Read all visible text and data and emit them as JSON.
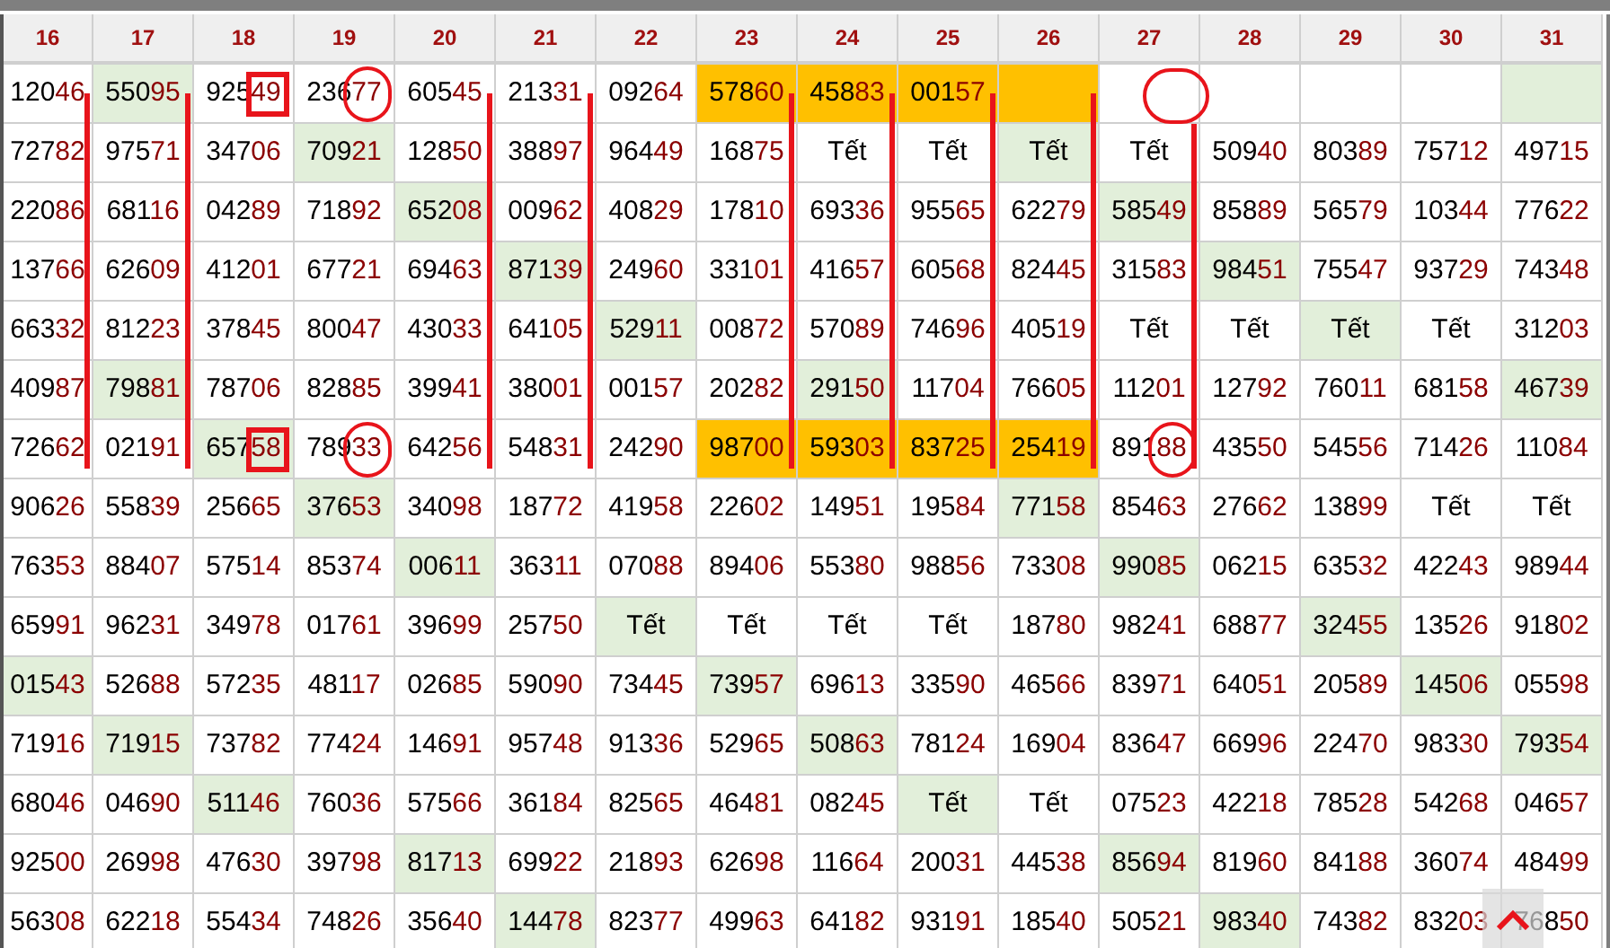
{
  "table": {
    "columns": [
      "16",
      "17",
      "18",
      "19",
      "20",
      "21",
      "22",
      "23",
      "24",
      "25",
      "26",
      "27",
      "28",
      "29",
      "30",
      "31"
    ],
    "rows": [
      {
        "cells": [
          {
            "text": "12046",
            "line": true
          },
          {
            "text": "55095",
            "color": "#e2efda",
            "line": true
          },
          {
            "text": "92549",
            "boxed": true
          },
          {
            "text": "23677",
            "circled": true
          },
          {
            "text": "60545",
            "line": true
          },
          {
            "text": "21331",
            "line": true
          },
          {
            "text": "09264"
          },
          {
            "text": "57860",
            "color": "#ffc000",
            "line": true
          },
          {
            "text": "45883",
            "color": "#ffc000",
            "line": true
          },
          {
            "text": "00157",
            "color": "#ffc000",
            "line": true
          },
          {
            "color": "#ffc000",
            "line": true
          },
          {
            "circled": true,
            "line": true
          },
          {},
          {},
          {},
          {
            "color": "#e2efda"
          }
        ]
      },
      {
        "cells": [
          {
            "text": "72782"
          },
          {
            "text": "97571"
          },
          {
            "text": "34706"
          },
          {
            "text": "70921",
            "color": "#e2efda"
          },
          {
            "text": "12850"
          },
          {
            "text": "38897"
          },
          {
            "text": "96449"
          },
          {
            "text": "16875"
          },
          {
            "text": "Tết"
          },
          {
            "text": "Tết"
          },
          {
            "text": "Tết",
            "color": "#e2efda"
          },
          {
            "text": "Tết"
          },
          {
            "text": "50940"
          },
          {
            "text": "80389"
          },
          {
            "text": "75712"
          },
          {
            "text": "49715"
          }
        ]
      },
      {
        "cells": [
          {
            "text": "22086"
          },
          {
            "text": "68116"
          },
          {
            "text": "04289"
          },
          {
            "text": "71892"
          },
          {
            "text": "65208",
            "color": "#e2efda"
          },
          {
            "text": "00962"
          },
          {
            "text": "40829"
          },
          {
            "text": "17810"
          },
          {
            "text": "69336"
          },
          {
            "text": "95565"
          },
          {
            "text": "62279"
          },
          {
            "text": "58549",
            "color": "#e2efda"
          },
          {
            "text": "85889"
          },
          {
            "text": "56579"
          },
          {
            "text": "10344"
          },
          {
            "text": "77622"
          }
        ]
      },
      {
        "cells": [
          {
            "text": "13766"
          },
          {
            "text": "62609"
          },
          {
            "text": "41201"
          },
          {
            "text": "67721"
          },
          {
            "text": "69463"
          },
          {
            "text": "87139",
            "color": "#e2efda"
          },
          {
            "text": "24960"
          },
          {
            "text": "33101"
          },
          {
            "text": "41657"
          },
          {
            "text": "60568"
          },
          {
            "text": "82445"
          },
          {
            "text": "31583"
          },
          {
            "text": "98451",
            "color": "#e2efda"
          },
          {
            "text": "75547"
          },
          {
            "text": "93729"
          },
          {
            "text": "74348"
          }
        ]
      },
      {
        "cells": [
          {
            "text": "66332"
          },
          {
            "text": "81223"
          },
          {
            "text": "37845"
          },
          {
            "text": "80047"
          },
          {
            "text": "43033"
          },
          {
            "text": "64105"
          },
          {
            "text": "52911",
            "color": "#e2efda"
          },
          {
            "text": "00872"
          },
          {
            "text": "57089"
          },
          {
            "text": "74696"
          },
          {
            "text": "40519"
          },
          {
            "text": "Tết"
          },
          {
            "text": "Tết"
          },
          {
            "text": "Tết",
            "color": "#e2efda"
          },
          {
            "text": "Tết"
          },
          {
            "text": "31203"
          }
        ]
      },
      {
        "cells": [
          {
            "text": "40987"
          },
          {
            "text": "79881",
            "color": "#e2efda"
          },
          {
            "text": "78706"
          },
          {
            "text": "82885"
          },
          {
            "text": "39941"
          },
          {
            "text": "38001"
          },
          {
            "text": "00157"
          },
          {
            "text": "20282"
          },
          {
            "text": "29150",
            "color": "#e2efda"
          },
          {
            "text": "11704"
          },
          {
            "text": "76605"
          },
          {
            "text": "11201"
          },
          {
            "text": "12792"
          },
          {
            "text": "76011"
          },
          {
            "text": "68158"
          },
          {
            "text": "46739",
            "color": "#e2efda"
          }
        ]
      },
      {
        "cells": [
          {
            "text": "72662",
            "line_end": true
          },
          {
            "text": "02191",
            "line_end": true
          },
          {
            "text": "65758",
            "color": "#e2efda",
            "boxed": true
          },
          {
            "text": "78933",
            "circled": true
          },
          {
            "text": "64256",
            "line_end": true
          },
          {
            "text": "54831",
            "line_end": true
          },
          {
            "text": "24290"
          },
          {
            "text": "98700",
            "color": "#ffc000",
            "line_end": true
          },
          {
            "text": "59303",
            "color": "#ffc000",
            "line_end": true
          },
          {
            "text": "83725",
            "color": "#ffc000",
            "line_end": true
          },
          {
            "text": "25419",
            "color": "#ffc000",
            "line_end": true
          },
          {
            "text": "89188",
            "circled": true,
            "line_end": true
          },
          {
            "text": "43550"
          },
          {
            "text": "54556"
          },
          {
            "text": "71426"
          },
          {
            "text": "11084"
          }
        ]
      },
      {
        "cells": [
          {
            "text": "90626"
          },
          {
            "text": "55839"
          },
          {
            "text": "25665"
          },
          {
            "text": "37653",
            "color": "#e2efda"
          },
          {
            "text": "34098"
          },
          {
            "text": "18772"
          },
          {
            "text": "41958"
          },
          {
            "text": "22602"
          },
          {
            "text": "14951"
          },
          {
            "text": "19584"
          },
          {
            "text": "77158",
            "color": "#e2efda"
          },
          {
            "text": "85463"
          },
          {
            "text": "27662"
          },
          {
            "text": "13899"
          },
          {
            "text": "Tết"
          },
          {
            "text": "Tết"
          }
        ]
      },
      {
        "cells": [
          {
            "text": "76353"
          },
          {
            "text": "88407"
          },
          {
            "text": "57514"
          },
          {
            "text": "85374"
          },
          {
            "text": "00611",
            "color": "#e2efda"
          },
          {
            "text": "36311"
          },
          {
            "text": "07088"
          },
          {
            "text": "89406"
          },
          {
            "text": "55380"
          },
          {
            "text": "98856"
          },
          {
            "text": "73308"
          },
          {
            "text": "99085",
            "color": "#e2efda"
          },
          {
            "text": "06215"
          },
          {
            "text": "63532"
          },
          {
            "text": "42243"
          },
          {
            "text": "98944"
          }
        ]
      },
      {
        "cells": [
          {
            "text": "65991"
          },
          {
            "text": "96231"
          },
          {
            "text": "34978"
          },
          {
            "text": "01761"
          },
          {
            "text": "39699"
          },
          {
            "text": "25750"
          },
          {
            "text": "Tết",
            "color": "#e2efda"
          },
          {
            "text": "Tết"
          },
          {
            "text": "Tết"
          },
          {
            "text": "Tết"
          },
          {
            "text": "18780"
          },
          {
            "text": "98241"
          },
          {
            "text": "68877"
          },
          {
            "text": "32455",
            "color": "#e2efda"
          },
          {
            "text": "13526"
          },
          {
            "text": "91802"
          }
        ]
      },
      {
        "cells": [
          {
            "text": "01543",
            "color": "#e2efda"
          },
          {
            "text": "52688"
          },
          {
            "text": "57235"
          },
          {
            "text": "48117"
          },
          {
            "text": "02685"
          },
          {
            "text": "59090"
          },
          {
            "text": "73445"
          },
          {
            "text": "73957",
            "color": "#e2efda"
          },
          {
            "text": "69613"
          },
          {
            "text": "33590"
          },
          {
            "text": "46566"
          },
          {
            "text": "83971"
          },
          {
            "text": "64051"
          },
          {
            "text": "20589"
          },
          {
            "text": "14506",
            "color": "#e2efda"
          },
          {
            "text": "05598"
          }
        ]
      },
      {
        "cells": [
          {
            "text": "71916"
          },
          {
            "text": "71915",
            "color": "#e2efda"
          },
          {
            "text": "73782"
          },
          {
            "text": "77424"
          },
          {
            "text": "14691"
          },
          {
            "text": "95748"
          },
          {
            "text": "91336"
          },
          {
            "text": "52965"
          },
          {
            "text": "50863",
            "color": "#e2efda"
          },
          {
            "text": "78124"
          },
          {
            "text": "16904"
          },
          {
            "text": "83647"
          },
          {
            "text": "66996"
          },
          {
            "text": "22470"
          },
          {
            "text": "98330"
          },
          {
            "text": "79354",
            "color": "#e2efda"
          }
        ]
      },
      {
        "cells": [
          {
            "text": "68046"
          },
          {
            "text": "04690"
          },
          {
            "text": "51146",
            "color": "#e2efda"
          },
          {
            "text": "76036"
          },
          {
            "text": "57566"
          },
          {
            "text": "36184"
          },
          {
            "text": "82565"
          },
          {
            "text": "46481"
          },
          {
            "text": "08245"
          },
          {
            "text": "Tết",
            "color": "#e2efda"
          },
          {
            "text": "Tết"
          },
          {
            "text": "07523"
          },
          {
            "text": "42218"
          },
          {
            "text": "78528"
          },
          {
            "text": "54268"
          },
          {
            "text": "04657"
          }
        ]
      },
      {
        "cells": [
          {
            "text": "92500"
          },
          {
            "text": "26998"
          },
          {
            "text": "47630"
          },
          {
            "text": "39798"
          },
          {
            "text": "81713",
            "color": "#e2efda"
          },
          {
            "text": "69922"
          },
          {
            "text": "21893"
          },
          {
            "text": "62698"
          },
          {
            "text": "11664"
          },
          {
            "text": "20031"
          },
          {
            "text": "44538"
          },
          {
            "text": "85694",
            "color": "#e2efda"
          },
          {
            "text": "81960"
          },
          {
            "text": "84188"
          },
          {
            "text": "36074"
          },
          {
            "text": "48499"
          }
        ]
      },
      {
        "cells": [
          {
            "text": "56308"
          },
          {
            "text": "62218"
          },
          {
            "text": "55434"
          },
          {
            "text": "74826"
          },
          {
            "text": "35640"
          },
          {
            "text": "14478",
            "color": "#e2efda"
          },
          {
            "text": "82377"
          },
          {
            "text": "49963"
          },
          {
            "text": "64182"
          },
          {
            "text": "93191"
          },
          {
            "text": "18540"
          },
          {
            "text": "50521"
          },
          {
            "text": "98340",
            "color": "#e2efda"
          },
          {
            "text": "74382"
          },
          {
            "text": "83203"
          },
          {
            "text": "76850"
          }
        ]
      }
    ]
  }
}
